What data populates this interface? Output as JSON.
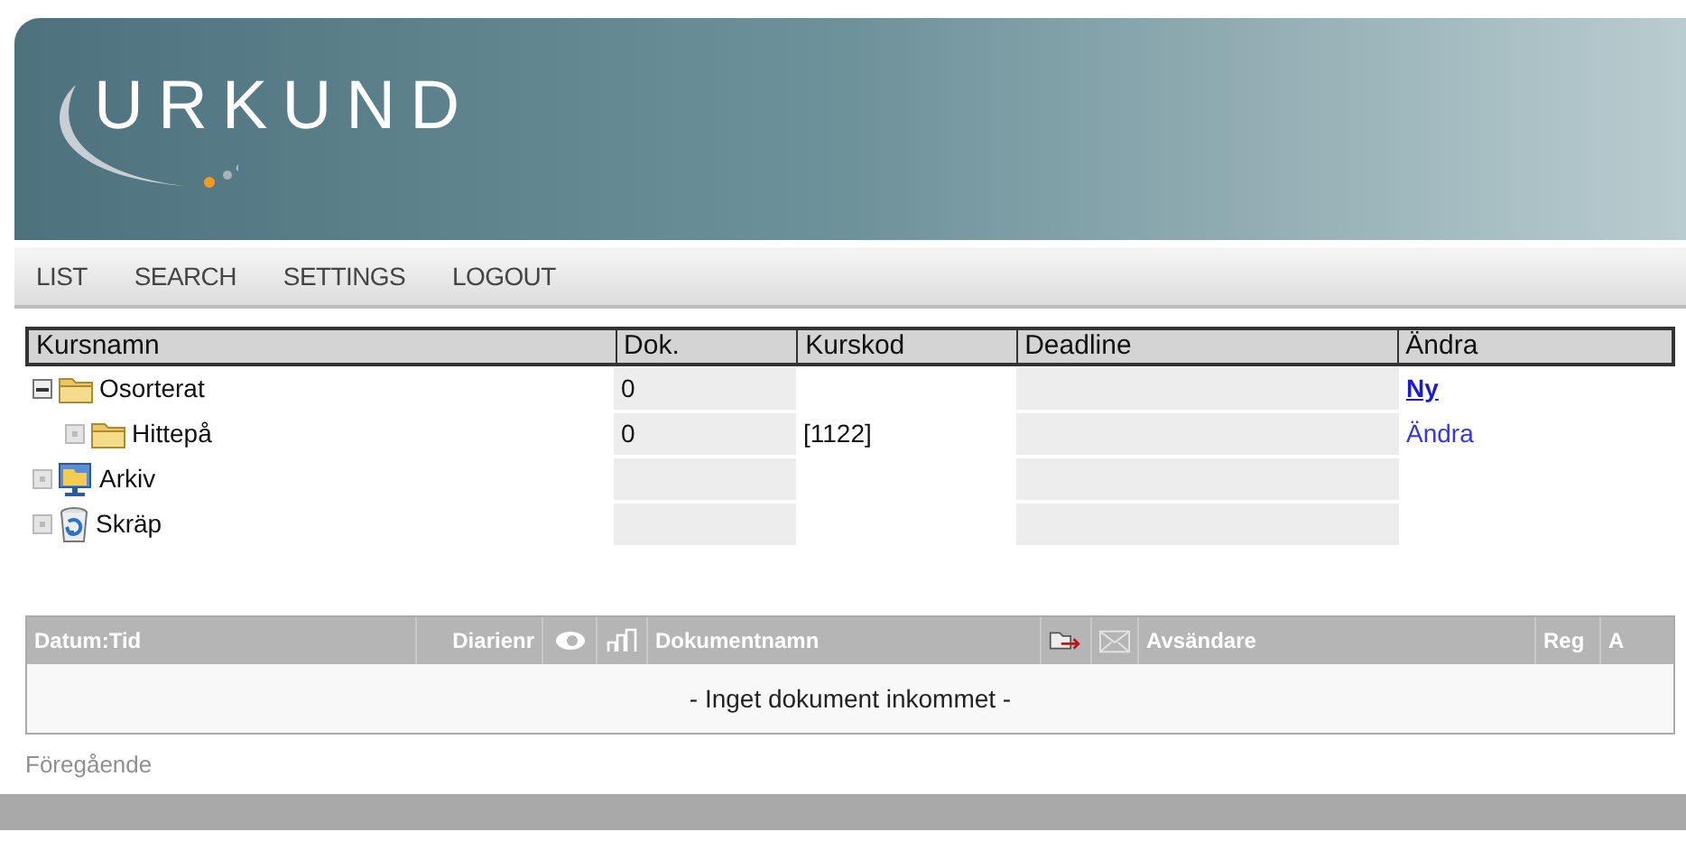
{
  "banner": {
    "logo": "URKUND"
  },
  "nav": [
    "LIST",
    "SEARCH",
    "SETTINGS",
    "LOGOUT"
  ],
  "courses": {
    "columns": [
      "Kursnamn",
      "Dok.",
      "Kurskod",
      "Deadline",
      "Ändra"
    ],
    "rows": [
      {
        "name": "Osorterat",
        "kind": "folder",
        "expanded": true,
        "dok": "0",
        "action": {
          "label": "Ny",
          "bold": true
        },
        "children": [
          {
            "name": "Hittepå",
            "kind": "folder",
            "expanded": false,
            "dok": "0",
            "kurskod": "[1122]",
            "action": {
              "label": "Ändra",
              "bold": false
            }
          }
        ]
      },
      {
        "name": "Arkiv",
        "kind": "archive",
        "expanded": false
      },
      {
        "name": "Skräp",
        "kind": "trash",
        "expanded": false
      }
    ]
  },
  "documents": {
    "columns": [
      "Datum:Tid",
      "Diarienr",
      "Dokumentnamn",
      "Avsändare",
      "Reg",
      "A"
    ],
    "empty_message": "- Inget dokument inkommet -"
  },
  "pagination": {
    "previous": "Föregående",
    "disabled": true
  }
}
